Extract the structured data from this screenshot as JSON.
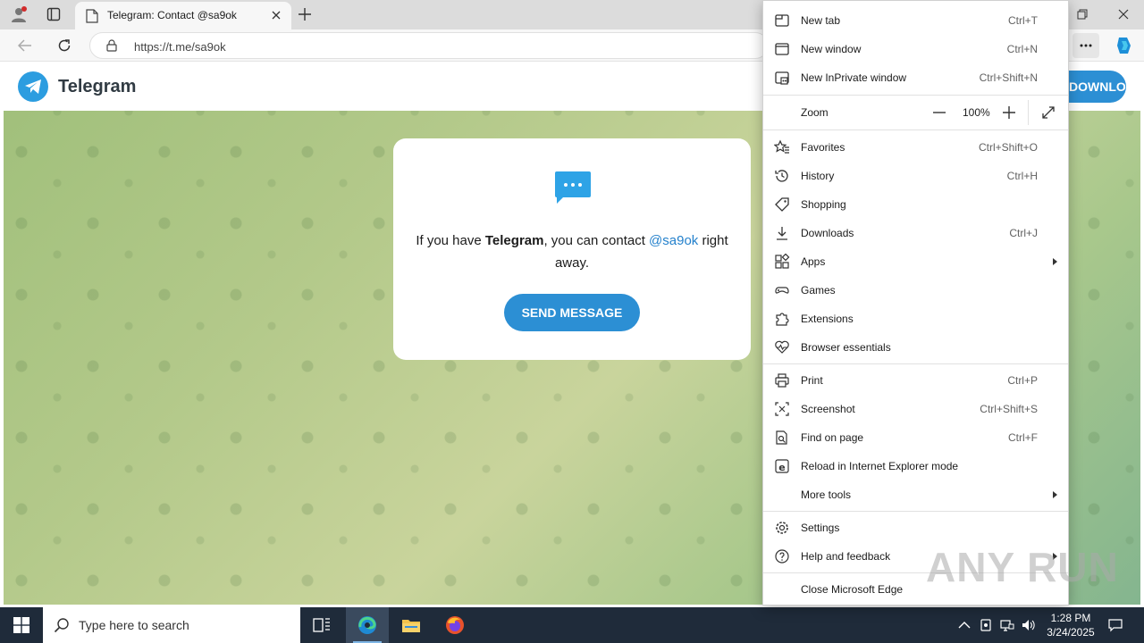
{
  "browser": {
    "tab": {
      "title": "Telegram: Contact @sa9ok"
    },
    "address": {
      "url": "https://t.me/sa9ok"
    }
  },
  "page": {
    "brand": "Telegram",
    "download_label": "DOWNLOAD",
    "card": {
      "text_before": "If you have ",
      "text_bold": "Telegram",
      "text_middle": ", you can contact ",
      "handle": "@sa9ok",
      "text_after": " right away.",
      "button_label": "SEND MESSAGE"
    }
  },
  "menu": {
    "new_tab": {
      "label": "New tab",
      "shortcut": "Ctrl+T"
    },
    "new_window": {
      "label": "New window",
      "shortcut": "Ctrl+N"
    },
    "new_inprivate": {
      "label": "New InPrivate window",
      "shortcut": "Ctrl+Shift+N"
    },
    "zoom": {
      "label": "Zoom",
      "value": "100%"
    },
    "favorites": {
      "label": "Favorites",
      "shortcut": "Ctrl+Shift+O"
    },
    "history": {
      "label": "History",
      "shortcut": "Ctrl+H"
    },
    "shopping": {
      "label": "Shopping"
    },
    "downloads": {
      "label": "Downloads",
      "shortcut": "Ctrl+J"
    },
    "apps": {
      "label": "Apps"
    },
    "games": {
      "label": "Games"
    },
    "extensions": {
      "label": "Extensions"
    },
    "browser_essentials": {
      "label": "Browser essentials"
    },
    "print": {
      "label": "Print",
      "shortcut": "Ctrl+P"
    },
    "screenshot": {
      "label": "Screenshot",
      "shortcut": "Ctrl+Shift+S"
    },
    "find": {
      "label": "Find on page",
      "shortcut": "Ctrl+F"
    },
    "ie_mode": {
      "label": "Reload in Internet Explorer mode"
    },
    "more_tools": {
      "label": "More tools"
    },
    "settings": {
      "label": "Settings"
    },
    "help": {
      "label": "Help and feedback"
    },
    "close": {
      "label": "Close Microsoft Edge"
    }
  },
  "taskbar": {
    "search_placeholder": "Type here to search",
    "time": "1:28 PM",
    "date": "3/24/2025"
  },
  "watermark": "ANY RUN",
  "colors": {
    "telegram_blue": "#2c8fd4",
    "taskbar": "#1f2b3a"
  }
}
